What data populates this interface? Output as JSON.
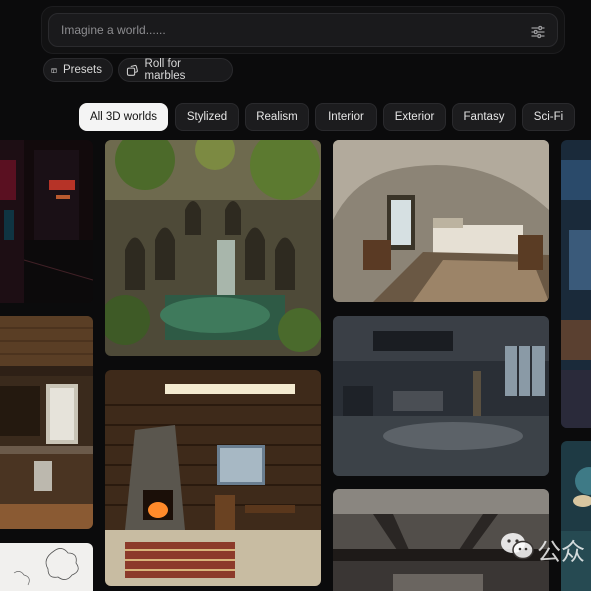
{
  "prompt": {
    "placeholder": "Imagine a world......",
    "value": ""
  },
  "actions": {
    "presets_label": "Presets",
    "roll_label": "Roll for marbles"
  },
  "filters": [
    {
      "label": "All 3D worlds",
      "active": true
    },
    {
      "label": "Stylized",
      "active": false
    },
    {
      "label": "Realism",
      "active": false
    },
    {
      "label": "Interior",
      "active": false
    },
    {
      "label": "Exterior",
      "active": false
    },
    {
      "label": "Fantasy",
      "active": false
    },
    {
      "label": "Sci-Fi",
      "active": false
    }
  ],
  "gallery": [
    {
      "scene": "neon-city-night"
    },
    {
      "scene": "overgrown-ruins-waterfall"
    },
    {
      "scene": "cave-bedroom"
    },
    {
      "scene": "blue-room-partial"
    },
    {
      "scene": "wooden-kitchen"
    },
    {
      "scene": "abandoned-dark-living-room"
    },
    {
      "scene": "log-cabin-fireplace"
    },
    {
      "scene": "white-sketch-partial"
    },
    {
      "scene": "wooden-beam-ceiling"
    },
    {
      "scene": "teal-fantasy-partial"
    }
  ],
  "watermark": {
    "text": "公众"
  },
  "colors": {
    "background": "#0b0b0c",
    "active_chip": "#f4f4f4",
    "chip": "#1c1c1e"
  }
}
